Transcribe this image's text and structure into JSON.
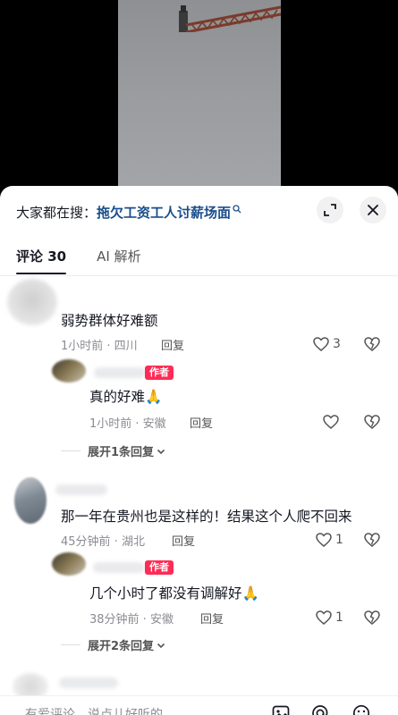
{
  "search": {
    "prefix": "大家都在搜：",
    "query": "拖欠工资工人讨薪场面"
  },
  "tabs": {
    "comments_label": "评论",
    "comments_count": "30",
    "ai_label": "AI 解析"
  },
  "comments": [
    {
      "text": "弱势群体好难额",
      "meta": "1小时前 · 四川",
      "reply_label": "回复",
      "likes": "3",
      "replies": [
        {
          "badge": "作者",
          "text": "真的好难🙏",
          "meta": "1小时前 · 安徽",
          "reply_label": "回复"
        }
      ],
      "expand_label": "展开1条回复"
    },
    {
      "text": "那一年在贵州也是这样的！结果这个人爬不回来",
      "meta": "45分钟前 · 湖北",
      "reply_label": "回复",
      "likes": "1",
      "replies": [
        {
          "badge": "作者",
          "text": "几个小时了都没有调解好🙏",
          "meta": "38分钟前 · 安徽",
          "reply_label": "回复",
          "likes": "1"
        }
      ],
      "expand_label": "展开2条回复"
    }
  ],
  "input": {
    "placeholder": "有爱评论，说点儿好听的"
  },
  "colors": {
    "link": "#1a4e8c",
    "badge": "#fe2c55",
    "meta": "#8a8b91"
  },
  "icons": [
    "search-icon",
    "expand-icon",
    "close-icon",
    "heart-icon",
    "dislike-icon",
    "chevron-down-icon",
    "image-icon",
    "at-icon",
    "emoji-icon"
  ]
}
